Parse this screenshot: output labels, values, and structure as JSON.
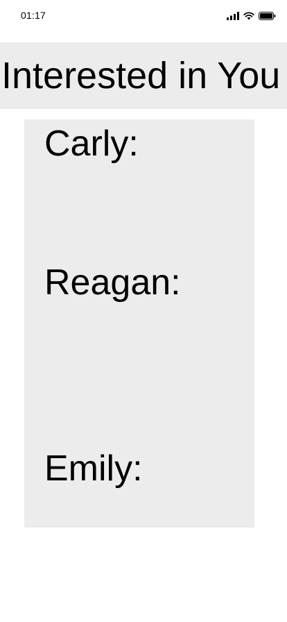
{
  "status_bar": {
    "time": "01:17",
    "icons": [
      "cellular-signal-icon",
      "wifi-icon",
      "battery-icon"
    ]
  },
  "header": {
    "title": "Interested in You"
  },
  "list": {
    "items": [
      {
        "label": "Carly:"
      },
      {
        "label": "Reagan:"
      },
      {
        "label": "Emily:"
      }
    ]
  },
  "colors": {
    "panel_background": "#ececec",
    "page_background": "#ffffff",
    "text": "#000000"
  }
}
